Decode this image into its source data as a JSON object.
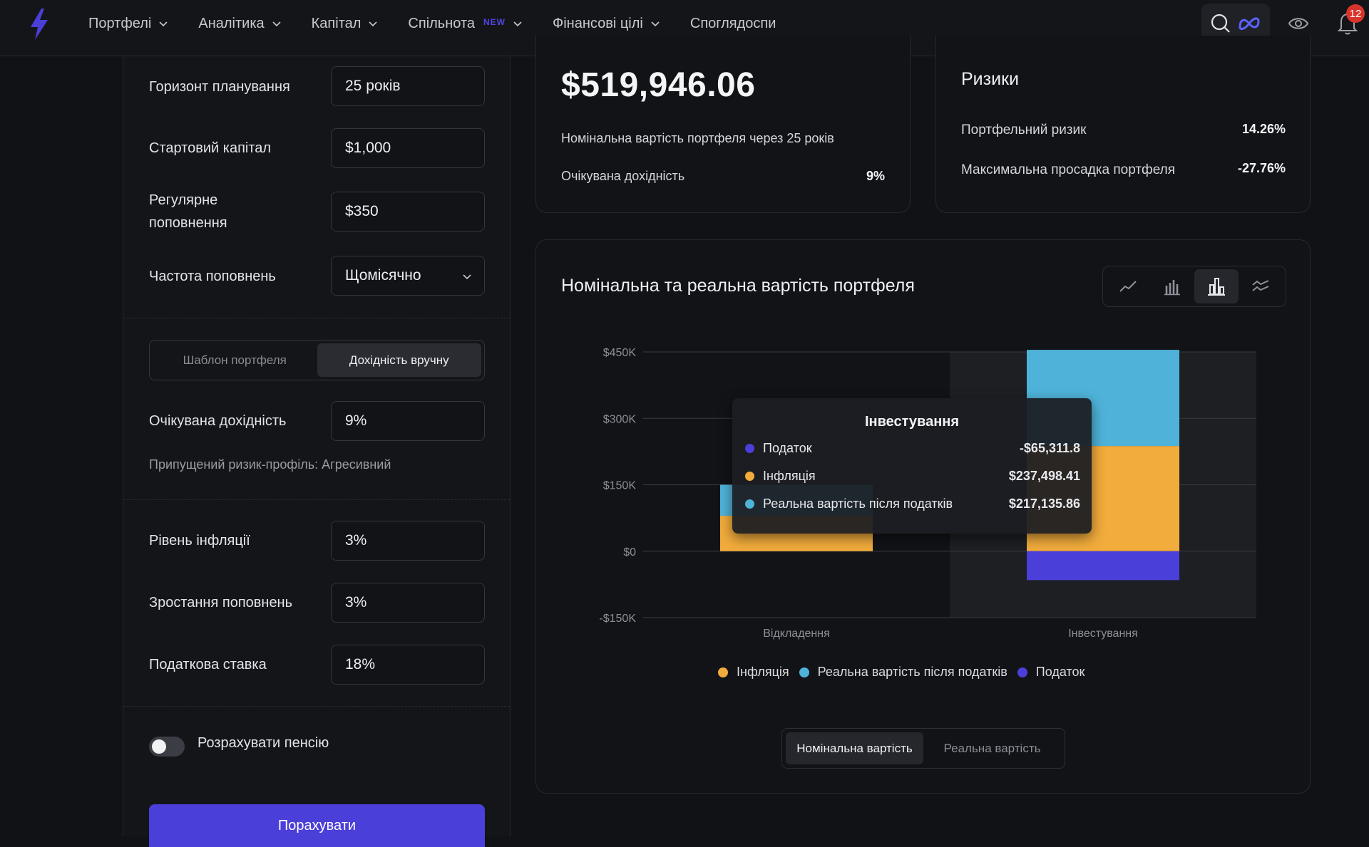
{
  "nav": {
    "items": [
      {
        "label": "Портфелі",
        "dropdown": true
      },
      {
        "label": "Аналітика",
        "dropdown": true
      },
      {
        "label": "Капітал",
        "dropdown": true
      },
      {
        "label": "Спільнота",
        "badge": "NEW",
        "dropdown": true
      },
      {
        "label": "Фінансові цілі",
        "dropdown": true
      },
      {
        "label": "Споглядоспи",
        "dropdown": false
      }
    ],
    "notifications": "12"
  },
  "form": {
    "horizon_label": "Горизонт планування",
    "horizon_value": "25 років",
    "start_capital_label": "Стартовий капітал",
    "start_capital_value": "$1,000",
    "regular_topup_label_1": "Регулярне",
    "regular_topup_label_2": "поповнення",
    "regular_topup_value": "$350",
    "frequency_label": "Частота поповнень",
    "frequency_value": "Щомісячно",
    "mode_tabs": [
      "Шаблон портфеля",
      "Дохідність вручну"
    ],
    "mode_active": 1,
    "expected_return_label": "Очікувана дохідність",
    "expected_return_value": "9%",
    "risk_profile_hint": "Припущений ризик-профіль: Агресивний",
    "inflation_label": "Рівень інфляції",
    "inflation_value": "3%",
    "topup_growth_label": "Зростання поповнень",
    "topup_growth_value": "3%",
    "tax_label": "Податкова ставка",
    "tax_value": "18%",
    "pension_toggle_label": "Розрахувати пенсію",
    "pension_toggle_on": false,
    "calculate_button": "Порахувати"
  },
  "summary": {
    "nominal_value": "$519,946.06",
    "nominal_caption": "Номінальна вартість портфеля через 25 років",
    "expected_return_label": "Очікувана дохідність",
    "expected_return_value": "9%"
  },
  "risks": {
    "title": "Ризики",
    "portfolio_risk_label": "Портфельний ризик",
    "portfolio_risk_value": "14.26%",
    "max_drawdown_label": "Максимальна просадка портфеля",
    "max_drawdown_value": "-27.76%"
  },
  "chart_card": {
    "title": "Номінальна та реальна вартість портфеля",
    "tools": [
      "line-chart-icon",
      "grouped-bar-icon",
      "stacked-bar-icon",
      "area-chart-icon"
    ],
    "active_tool": 2,
    "value_switch": [
      "Номінальна вартість",
      "Реальна вартість"
    ],
    "value_switch_active": 0
  },
  "tooltip": {
    "title": "Інвестування",
    "rows": [
      {
        "label": "Податок",
        "value": "-$65,311.8",
        "color": "#4b3fd9"
      },
      {
        "label": "Інфляція",
        "value": "$237,498.41",
        "color": "#f2ac3c"
      },
      {
        "label": "Реальна вартість після податків",
        "value": "$217,135.86",
        "color": "#4fb3d9"
      }
    ]
  },
  "chart_data": {
    "type": "bar",
    "stacked": true,
    "categories": [
      "Відкладення",
      "Інвестування"
    ],
    "series": [
      {
        "name": "Інфляція",
        "color": "#f2ac3c",
        "values": [
          80000,
          237498.41
        ]
      },
      {
        "name": "Реальна вартість після податків",
        "color": "#4fb3d9",
        "values": [
          70000,
          217135.86
        ]
      },
      {
        "name": "Податок",
        "color": "#4b3fd9",
        "values": [
          0,
          -65311.8
        ]
      }
    ],
    "yticks": [
      "$450K",
      "$300K",
      "$150K",
      "$0",
      "-$150K"
    ],
    "ytick_values": [
      450000,
      300000,
      150000,
      0,
      -150000
    ],
    "ylim": [
      -150000,
      450000
    ],
    "highlighted_category": "Інвестування",
    "legend_position": "bottom",
    "grid": true
  }
}
